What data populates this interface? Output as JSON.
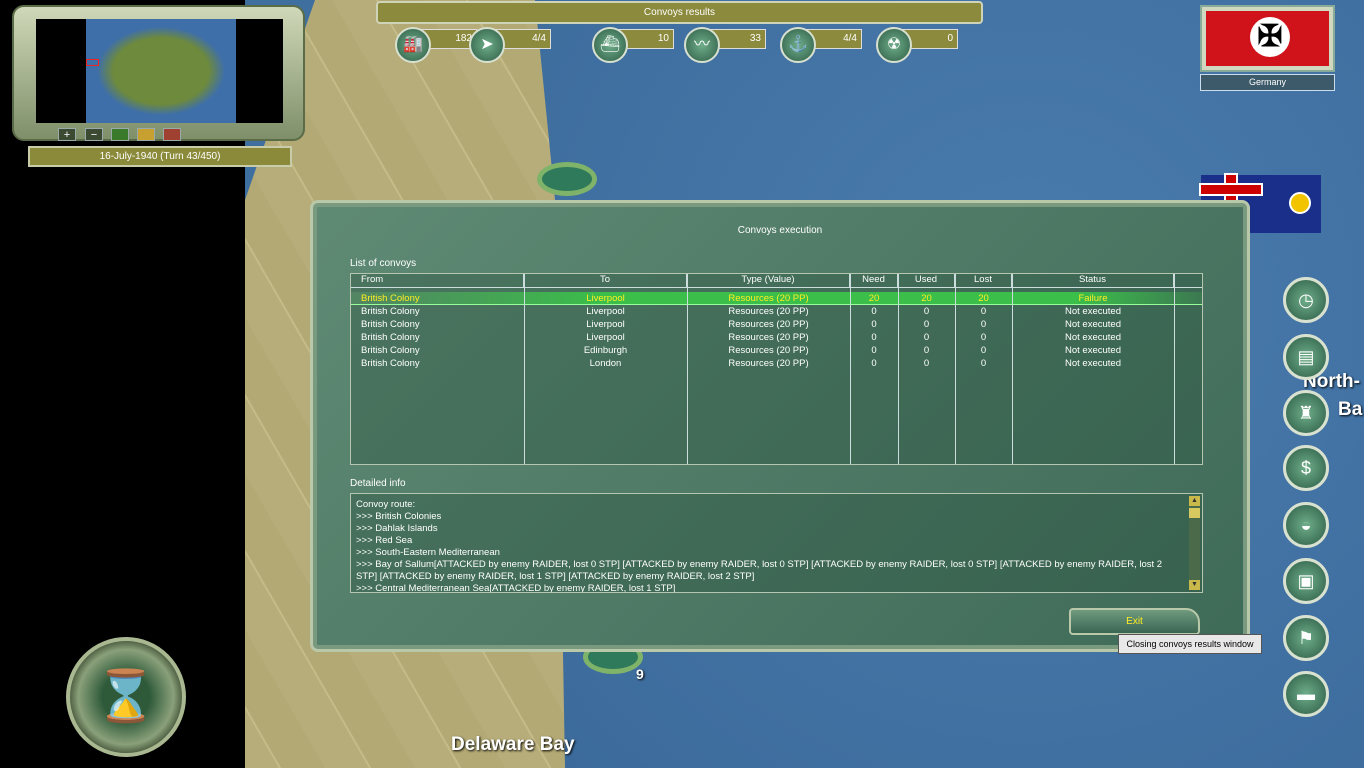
{
  "top_bar": {
    "title": "Convoys results"
  },
  "resources": [
    {
      "icon": "industry-icon",
      "glyph": "🏭",
      "value": "182"
    },
    {
      "icon": "arrow-icon",
      "glyph": "➤",
      "value": "4/4"
    },
    {
      "icon": "ship-icon",
      "glyph": "⛴",
      "value": "10"
    },
    {
      "icon": "map-icon",
      "glyph": "〰",
      "value": "33"
    },
    {
      "icon": "submarine-icon",
      "glyph": "⚓",
      "value": "4/4"
    },
    {
      "icon": "nuclear-icon",
      "glyph": "☢",
      "value": "0"
    }
  ],
  "minimap": {
    "zoom_in": "+",
    "zoom_out": "−"
  },
  "date": "16-July-1940 (Turn 43/450)",
  "nation": {
    "name": "Germany",
    "symbol": "✠"
  },
  "map_labels": {
    "delaware": "Delaware Bay",
    "north": "North-",
    "ba": "Ba",
    "count": "9"
  },
  "dialog": {
    "title": "Convoys execution",
    "list_label": "List of convoys",
    "columns": [
      "From",
      "To",
      "Type (Value)",
      "Need",
      "Used",
      "Lost",
      "Status"
    ],
    "rows": [
      [
        "British Colony",
        "Liverpool",
        "Resources (20 PP)",
        "20",
        "20",
        "20",
        "Failure"
      ],
      [
        "British Colony",
        "Liverpool",
        "Resources (20 PP)",
        "0",
        "0",
        "0",
        "Not executed"
      ],
      [
        "British Colony",
        "Liverpool",
        "Resources (20 PP)",
        "0",
        "0",
        "0",
        "Not executed"
      ],
      [
        "British Colony",
        "Liverpool",
        "Resources (20 PP)",
        "0",
        "0",
        "0",
        "Not executed"
      ],
      [
        "British Colony",
        "Edinburgh",
        "Resources (20 PP)",
        "0",
        "0",
        "0",
        "Not executed"
      ],
      [
        "British Colony",
        "London",
        "Resources (20 PP)",
        "0",
        "0",
        "0",
        "Not executed"
      ]
    ],
    "detail_label": "Detailed info",
    "detail_lines": [
      "Convoy route:",
      ">>> British Colonies",
      ">>> Dahlak Islands",
      ">>> Red Sea",
      ">>> South-Eastern Mediterranean",
      ">>> Bay of Sallum[ATTACKED by enemy RAIDER, lost 0 STP] [ATTACKED by enemy RAIDER, lost 0 STP] [ATTACKED by enemy RAIDER, lost 0 STP] [ATTACKED by enemy RAIDER, lost 2 STP] [ATTACKED by enemy RAIDER, lost 1 STP] [ATTACKED by enemy RAIDER, lost 2 STP]",
      ">>> Central Mediterranean Sea[ATTACKED by enemy RAIDER, lost 1 STP]"
    ],
    "exit_label": "Exit",
    "exit_tooltip": "Closing convoys results window"
  },
  "side_buttons": [
    {
      "name": "clock-icon",
      "glyph": "◷"
    },
    {
      "name": "diplomacy-icon",
      "glyph": "▤"
    },
    {
      "name": "production-icon",
      "glyph": "♜"
    },
    {
      "name": "money-icon",
      "glyph": "$"
    },
    {
      "name": "research-icon",
      "glyph": "◒"
    },
    {
      "name": "computer-icon",
      "glyph": "▣"
    },
    {
      "name": "history-icon",
      "glyph": "⚑"
    },
    {
      "name": "book-icon",
      "glyph": "▬"
    }
  ],
  "end_turn_glyph": "⌛"
}
